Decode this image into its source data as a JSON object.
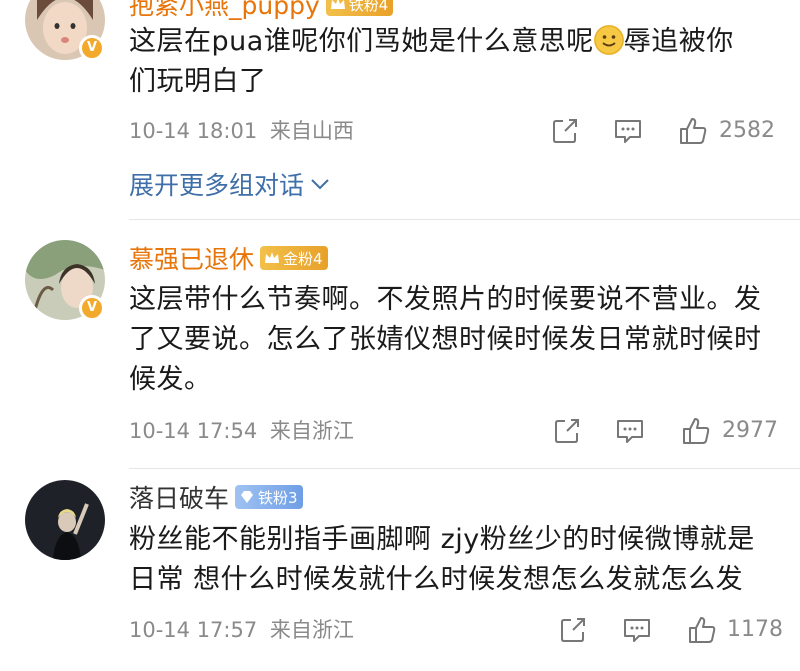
{
  "comments": [
    {
      "username": "抱紧小燕_puppy",
      "badge": "铁粉4",
      "verified": true,
      "text_line1": "这层在pua谁呢你们骂她是什么意思呢",
      "text_line1b": "辱追被你",
      "text_line2": "们玩明白了",
      "time": "10-14 18:01",
      "location": "来自山西",
      "likes": "2582"
    },
    {
      "username": "慕强已退休",
      "badge": "金粉4",
      "verified": true,
      "text": "这层带什么节奏啊。不发照片的时候要说不营业。发了又要说。怎么了张婧仪想时候时候发日常就时候时候发。",
      "time": "10-14 17:54",
      "location": "来自浙江",
      "likes": "2977"
    },
    {
      "username": "落日破车",
      "badge": "铁粉3",
      "verified": false,
      "text": "粉丝能不能别指手画脚啊 zjy粉丝少的时候微博就是日常 想什么时候发就什么时候发想怎么发就怎么发",
      "time": "10-14 17:57",
      "location": "来自浙江",
      "likes": "1178"
    }
  ],
  "expand_label": "展开更多组对话",
  "colors": {
    "link": "#3f6fa8",
    "orange_name": "#e8750a",
    "meta": "#8a8a8a"
  },
  "icons": [
    "share-icon",
    "comment-icon",
    "like-icon",
    "chevron-down-icon",
    "verified-badge-icon",
    "crown-icon",
    "diamond-icon",
    "smile-emoji"
  ]
}
